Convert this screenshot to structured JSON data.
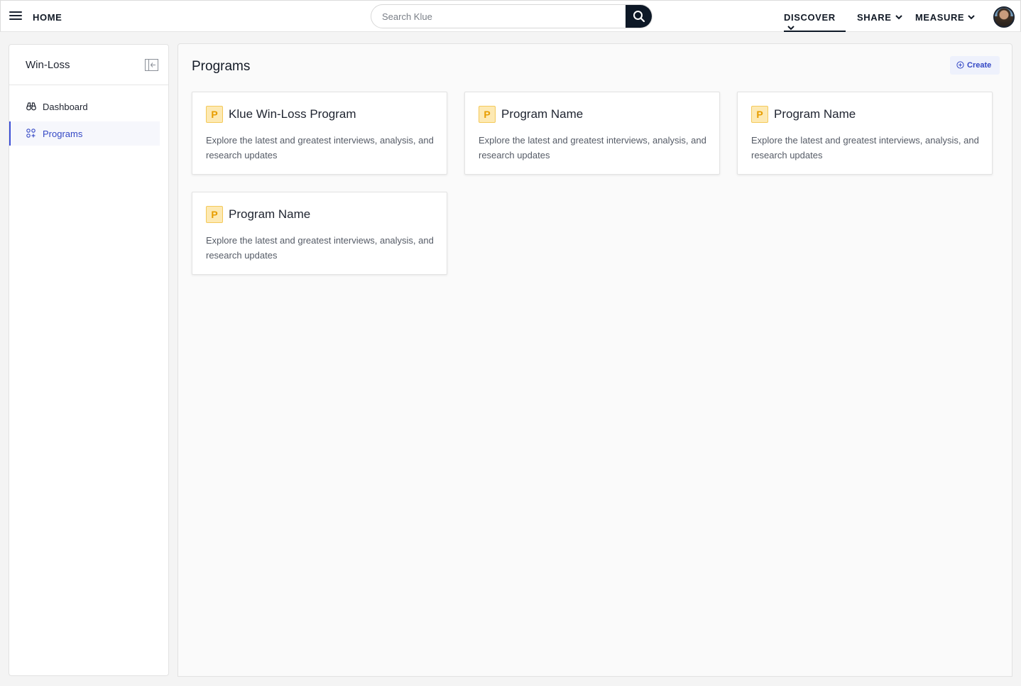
{
  "topbar": {
    "home_label": "HOME",
    "search_placeholder": "Search Klue",
    "nav": [
      {
        "label": "DISCOVER",
        "active": true
      },
      {
        "label": "SHARE",
        "active": false
      },
      {
        "label": "MEASURE",
        "active": false
      }
    ]
  },
  "sidebar": {
    "title": "Win-Loss",
    "items": [
      {
        "label": "Dashboard",
        "icon": "binoculars-icon",
        "active": false
      },
      {
        "label": "Programs",
        "icon": "grid-plus-icon",
        "active": true
      }
    ]
  },
  "main": {
    "title": "Programs",
    "create_label": "Create",
    "cards": [
      {
        "badge": "P",
        "title": "Klue Win-Loss Program",
        "description": "Explore the latest and greatest interviews, analysis, and research updates"
      },
      {
        "badge": "P",
        "title": "Program Name",
        "description": "Explore the latest and greatest interviews, analysis, and research updates"
      },
      {
        "badge": "P",
        "title": "Program Name",
        "description": "Explore the latest and greatest interviews, analysis, and research updates"
      },
      {
        "badge": "P",
        "title": "Program Name",
        "description": "Explore the latest and greatest interviews, analysis, and research updates"
      }
    ]
  },
  "colors": {
    "accent": "#3448c5",
    "dark": "#0d1826",
    "badge_bg": "#fde9b3",
    "badge_text": "#e79d00"
  }
}
